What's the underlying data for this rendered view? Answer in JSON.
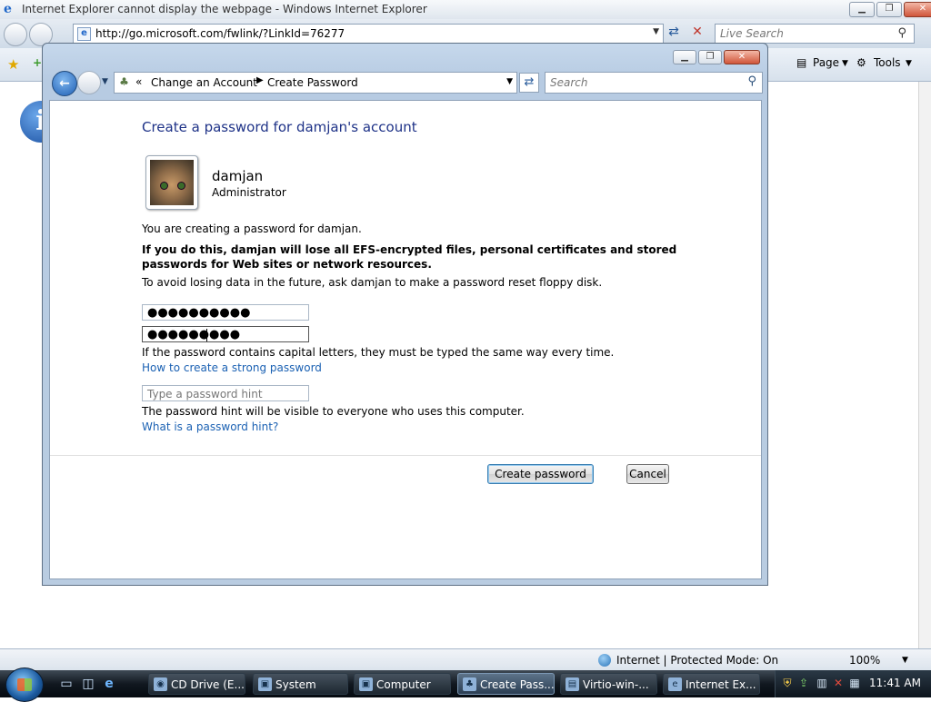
{
  "ie": {
    "title": "Internet Explorer cannot display the webpage - Windows Internet Explorer",
    "address": "http://go.microsoft.com/fwlink/?LinkId=76277",
    "live_search_placeholder": "Live Search",
    "toolbar": {
      "page_label": "Page",
      "tools_label": "Tools"
    },
    "status": {
      "zone": "Internet | Protected Mode: On",
      "zoom": "100%"
    }
  },
  "dialog": {
    "breadcrumb": [
      "Change an Account",
      "Create Password"
    ],
    "search_placeholder": "Search",
    "heading": "Create a password for damjan's account",
    "user": {
      "name": "damjan",
      "role": "Administrator"
    },
    "info_line": "You are creating a password for damjan.",
    "warning": "If you do this, damjan will lose all EFS-encrypted files, personal certificates and stored passwords for Web sites or network resources.",
    "advice": "To avoid losing data in the future, ask damjan to make a password reset floppy disk.",
    "password_mask": "●●●●●●●●●●",
    "confirm_mask": "●●●●●●●●●",
    "caps_note": "If the password contains capital letters, they must be typed the same way every time.",
    "strong_link": "How to create a strong password",
    "hint_placeholder": "Type a password hint",
    "hint_note": "The password hint will be visible to everyone who uses this computer.",
    "hint_link": "What is a password hint?",
    "create_button": "Create password",
    "cancel_button": "Cancel"
  },
  "taskbar": {
    "tasks": [
      "CD Drive (E...",
      "System",
      "Computer",
      "Create Pass...",
      "Virtio-win-...",
      "Internet Ex..."
    ],
    "active_index": 3,
    "clock": "11:41 AM"
  },
  "colors": {
    "heading": "#1e3287",
    "link": "#1b61b3",
    "taskbar": "#111820"
  }
}
